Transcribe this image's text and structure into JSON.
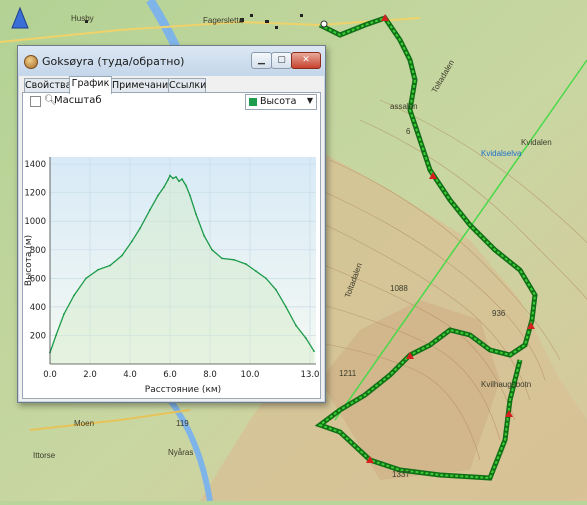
{
  "map": {
    "labels": {
      "husby": "Husby",
      "fagersletta": "Fagersletta",
      "assalen": "assalen",
      "kvidalselva": "Kvidalselva",
      "kvidalen": "Kvidalen",
      "toltadalen": "Toltadalen",
      "toltadalen2": "Toltadalen",
      "h1088": "1088",
      "h936": "936",
      "h1211": "1211",
      "kvilhaugsbotn": "Kvilhaugsbotn",
      "h1337": "1337",
      "moen": "Moen",
      "ittorse": "Ittorse",
      "nyaras": "Nyåras",
      "h119": "119",
      "h6": "6"
    },
    "colors": {
      "terrain": "#b9d59a",
      "route": "#1e9b1e",
      "marker": "#d62020",
      "river": "#7fb4e8"
    }
  },
  "window": {
    "title": "Goksøyra (туда/обратно)",
    "controls": {
      "minimize": "▁",
      "maximize": "▢",
      "close": "✕"
    },
    "tabs": [
      "Свойства",
      "График",
      "Примечания",
      "Ссылки"
    ],
    "active_tab": "График",
    "toolbar": {
      "scale_label": "Масштаб",
      "scale_checked": false,
      "series_selected": "Высота"
    },
    "colors": {
      "series": "#1e9b4b",
      "plot_top": "#d8eaf7",
      "plot_bottom": "#f4f9f2"
    }
  },
  "chart_data": {
    "type": "area",
    "xlabel": "Расстояние (км)",
    "ylabel": "Высота (м)",
    "xlim": [
      0,
      13.3
    ],
    "ylim": [
      0,
      1450
    ],
    "xticks": [
      "0.0",
      "2.0",
      "4.0",
      "6.0",
      "8.0",
      "10.0",
      "13.0"
    ],
    "xtick_values": [
      0,
      2,
      4,
      6,
      8,
      10,
      13
    ],
    "yticks": [
      "200",
      "400",
      "600",
      "800",
      "1000",
      "1200",
      "1400"
    ],
    "ytick_values": [
      200,
      400,
      600,
      800,
      1000,
      1200,
      1400
    ],
    "grid": true,
    "series": [
      {
        "x": [
          0,
          0.3,
          0.7,
          1.2,
          1.8,
          2.4,
          3.0,
          3.6,
          4.1,
          4.5,
          5.0,
          5.4,
          5.7,
          5.9,
          6.0,
          6.15,
          6.3,
          6.45,
          6.6,
          6.8,
          7.0,
          7.3,
          7.7,
          8.1,
          8.6,
          9.2,
          9.8,
          10.3,
          10.8,
          11.3,
          11.8,
          12.3,
          12.8,
          13.2
        ],
        "y": [
          80,
          200,
          350,
          480,
          600,
          660,
          690,
          760,
          860,
          950,
          1080,
          1180,
          1240,
          1290,
          1320,
          1300,
          1310,
          1280,
          1295,
          1250,
          1180,
          1050,
          900,
          800,
          740,
          730,
          700,
          650,
          600,
          520,
          400,
          270,
          180,
          90
        ]
      }
    ]
  }
}
